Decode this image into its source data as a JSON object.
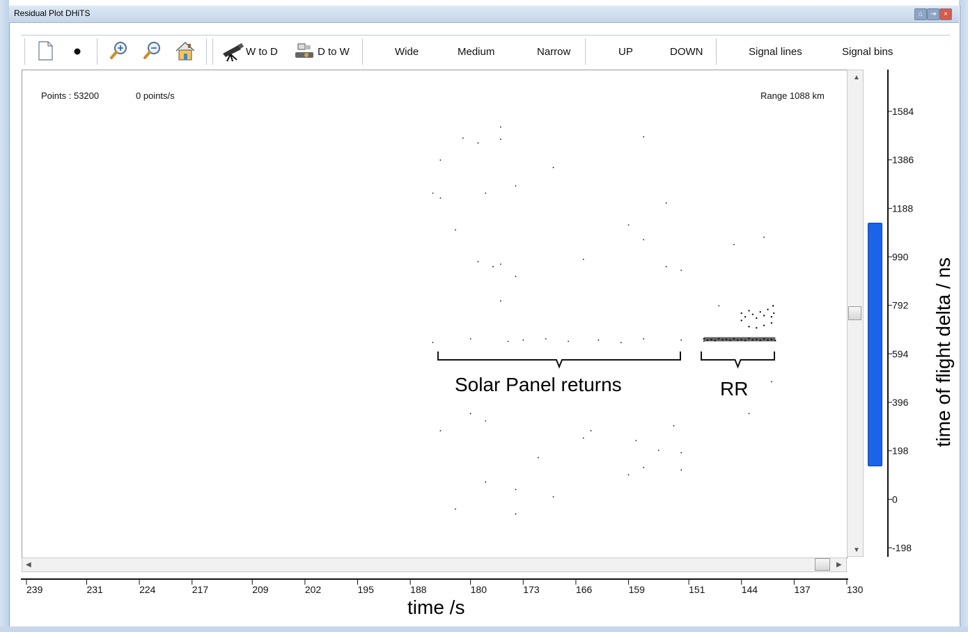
{
  "window": {
    "title": "Residual Plot DHiTS"
  },
  "toolbar": {
    "w_to_d": "W to D",
    "d_to_w": "D to W",
    "wide": "Wide",
    "medium": "Medium",
    "narrow": "Narrow",
    "up": "UP",
    "down": "DOWN",
    "signal_lines": "Signal lines",
    "signal_bins": "Signal bins"
  },
  "status": {
    "points": "Points : 53200",
    "rate": "0 points/s",
    "range": "Range 1088 km"
  },
  "annotations": {
    "solar": "Solar Panel returns",
    "rr": "RR"
  },
  "colors": {
    "accent": "#1b63ea",
    "title_bar": "#c4d5ea"
  },
  "chart_data": {
    "type": "scatter",
    "xlabel": "time /s",
    "ylabel": "time of flight delta / ns",
    "x_ticks": [
      "239",
      "231",
      "224",
      "217",
      "209",
      "202",
      "195",
      "188",
      "180",
      "173",
      "166",
      "159",
      "151",
      "144",
      "137",
      "130"
    ],
    "y_ticks": [
      "1584",
      "1386",
      "1188",
      "990",
      "792",
      "594",
      "396",
      "198",
      "0",
      "-198"
    ],
    "xlim": [
      239,
      130
    ],
    "ylim": [
      -198,
      1584
    ],
    "points": [
      [
        181,
        1475
      ],
      [
        179,
        1455
      ],
      [
        176,
        1520
      ],
      [
        176,
        1470
      ],
      [
        157,
        1480
      ],
      [
        184,
        1385
      ],
      [
        169,
        1355
      ],
      [
        185,
        1250
      ],
      [
        184,
        1230
      ],
      [
        178,
        1250
      ],
      [
        174,
        1280
      ],
      [
        154,
        1210
      ],
      [
        182,
        1100
      ],
      [
        159,
        1120
      ],
      [
        157,
        1060
      ],
      [
        145,
        1040
      ],
      [
        141,
        1070
      ],
      [
        179,
        970
      ],
      [
        176,
        960
      ],
      [
        177,
        950
      ],
      [
        174,
        910
      ],
      [
        165,
        980
      ],
      [
        154,
        950
      ],
      [
        152,
        935
      ],
      [
        176,
        810
      ],
      [
        147,
        790
      ],
      [
        185,
        640
      ],
      [
        180,
        655
      ],
      [
        175,
        645
      ],
      [
        173,
        650
      ],
      [
        170,
        655
      ],
      [
        167,
        645
      ],
      [
        163,
        650
      ],
      [
        160,
        640
      ],
      [
        157,
        655
      ],
      [
        152,
        650
      ],
      [
        149,
        645
      ],
      [
        180,
        350
      ],
      [
        178,
        320
      ],
      [
        164,
        280
      ],
      [
        153,
        300
      ],
      [
        184,
        280
      ],
      [
        165,
        250
      ],
      [
        158,
        240
      ],
      [
        155,
        200
      ],
      [
        152,
        190
      ],
      [
        171,
        170
      ],
      [
        157,
        130
      ],
      [
        152,
        120
      ],
      [
        159,
        100
      ],
      [
        178,
        70
      ],
      [
        174,
        40
      ],
      [
        169,
        10
      ],
      [
        182,
        -40
      ],
      [
        174,
        -60
      ],
      [
        140,
        480
      ],
      [
        143,
        350
      ]
    ],
    "rr_points": [
      [
        149,
        655
      ],
      [
        148.5,
        650
      ],
      [
        148,
        652
      ],
      [
        147.5,
        648
      ],
      [
        147,
        656
      ],
      [
        146.5,
        651
      ],
      [
        146,
        653
      ],
      [
        145.5,
        649
      ],
      [
        145,
        655
      ],
      [
        144.5,
        650
      ],
      [
        144,
        652
      ],
      [
        143.5,
        648
      ],
      [
        143,
        657
      ],
      [
        142.5,
        651
      ],
      [
        142,
        653
      ],
      [
        141.5,
        649
      ],
      [
        141,
        655
      ],
      [
        140.5,
        650
      ],
      [
        140,
        652
      ],
      [
        139.5,
        648
      ],
      [
        144,
        760
      ],
      [
        143.5,
        745
      ],
      [
        143,
        770
      ],
      [
        142.5,
        755
      ],
      [
        142,
        740
      ],
      [
        141.5,
        765
      ],
      [
        141,
        750
      ],
      [
        140.5,
        775
      ],
      [
        140,
        745
      ],
      [
        139.8,
        790
      ],
      [
        142,
        700
      ],
      [
        141,
        710
      ],
      [
        143,
        705
      ],
      [
        140,
        720
      ],
      [
        144,
        730
      ],
      [
        139.7,
        760
      ]
    ]
  }
}
